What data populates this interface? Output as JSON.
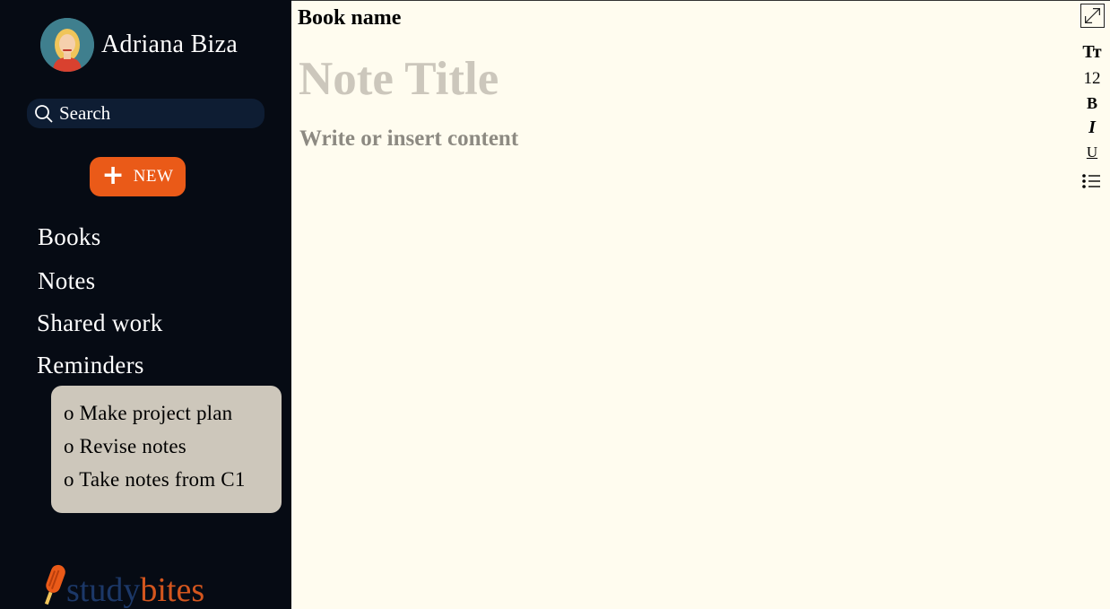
{
  "user": {
    "name": "Adriana Biza",
    "avatar_icon": "avatar-woman-blonde"
  },
  "search": {
    "placeholder": "Search"
  },
  "new_button": {
    "label": "NEW",
    "color": "#ea5a18"
  },
  "nav": {
    "books": "Books",
    "notes": "Notes",
    "shared_work": "Shared work",
    "reminders": "Reminders"
  },
  "reminders": {
    "items": [
      "o Make project plan",
      "o Revise notes",
      "o Take notes from C1"
    ]
  },
  "logo": {
    "study": "study",
    "bites": "bites",
    "icon": "popsicle-icon"
  },
  "editor": {
    "book_name": "Book name",
    "title_placeholder": "Note Title",
    "content_placeholder": "Write or insert content"
  },
  "toolbar": {
    "text_size_label": "Tт",
    "font_size": "12",
    "bold_label": "B",
    "italic_label": "I",
    "underline_label": "U"
  },
  "colors": {
    "sidebar_bg": "#060b14",
    "editor_bg": "#fffcef",
    "accent": "#ea5a18",
    "reminder_bg": "#cdc7bb"
  }
}
